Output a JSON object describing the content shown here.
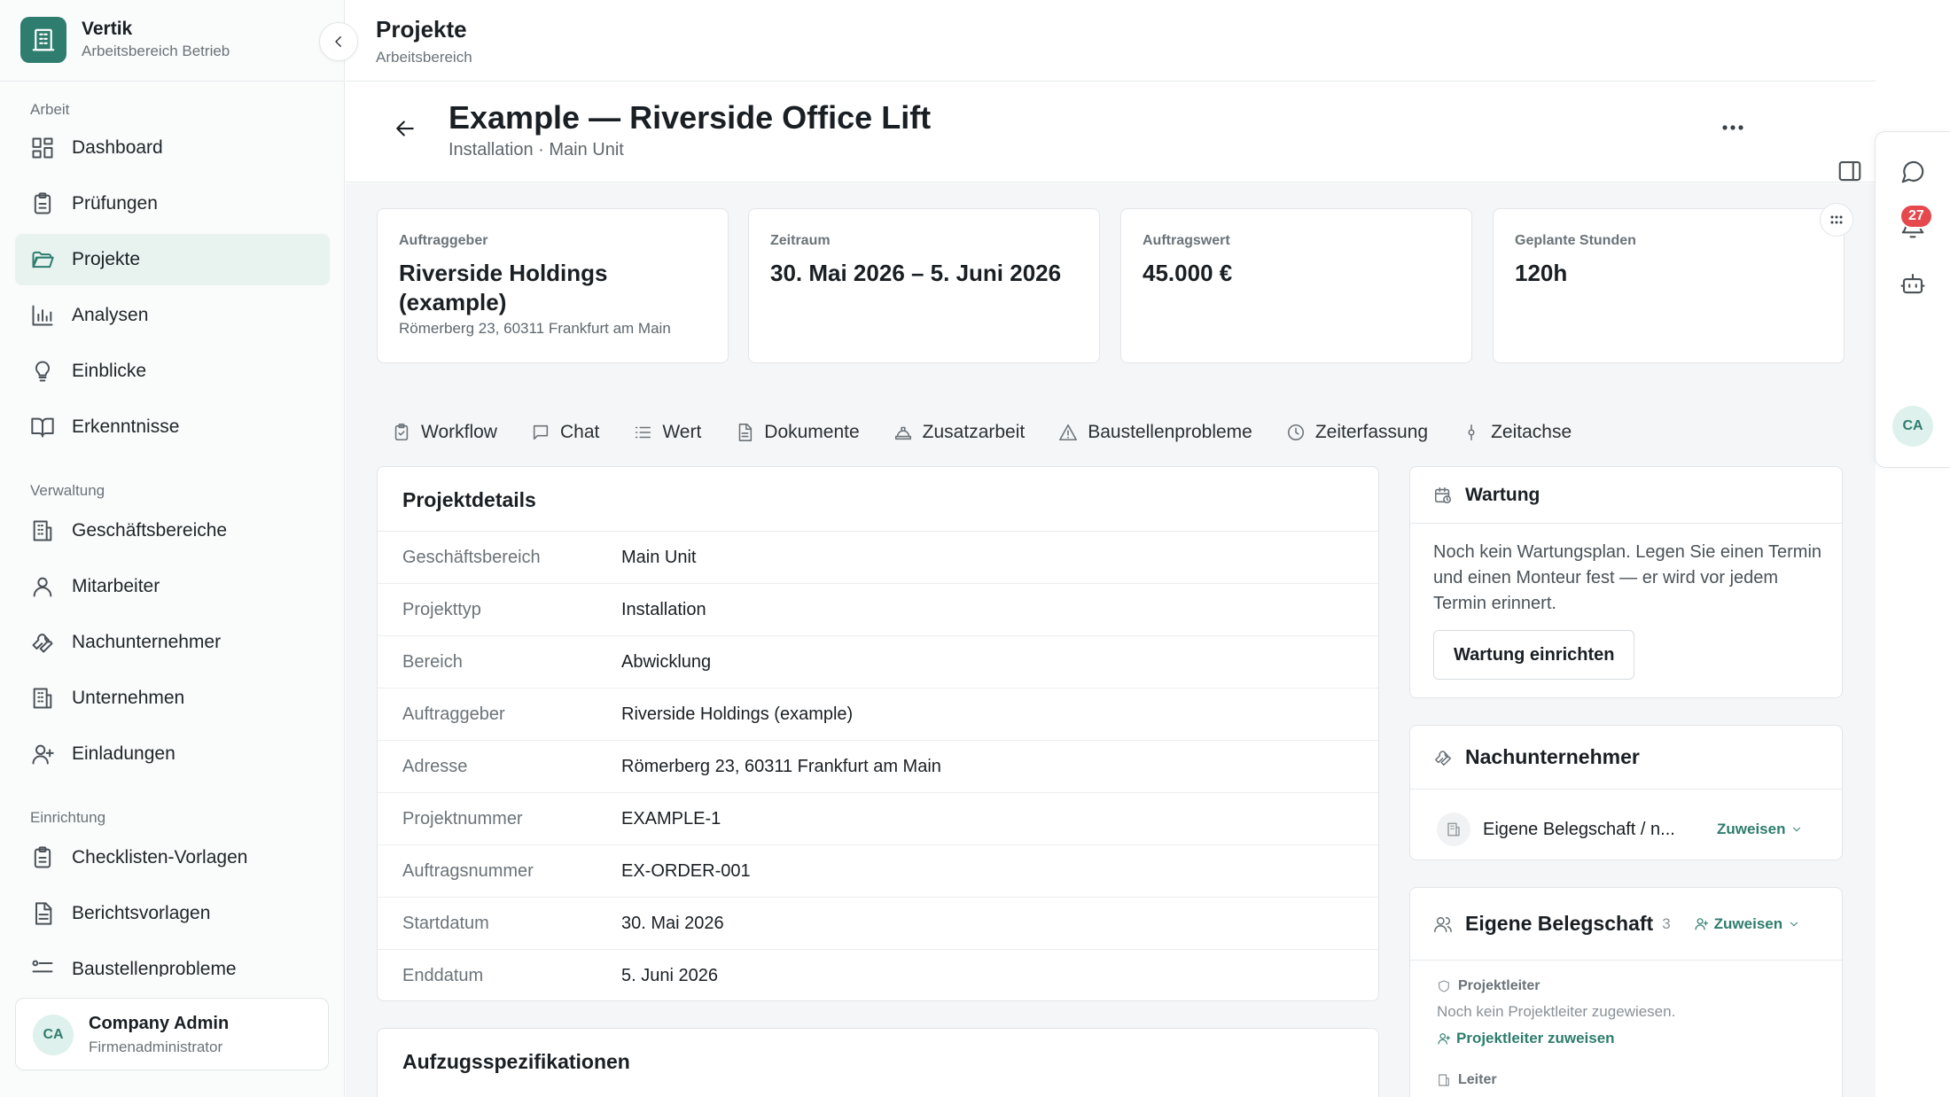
{
  "brand": {
    "name": "Vertik",
    "workspace": "Arbeitsbereich Betrieb"
  },
  "nav": {
    "sections": [
      {
        "label": "Arbeit",
        "items": [
          {
            "label": "Dashboard",
            "icon": "dashboard-icon"
          },
          {
            "label": "Prüfungen",
            "icon": "clipboard-icon"
          },
          {
            "label": "Projekte",
            "icon": "folder-open-icon",
            "active": true
          },
          {
            "label": "Analysen",
            "icon": "bar-chart-icon"
          },
          {
            "label": "Einblicke",
            "icon": "lightbulb-icon"
          },
          {
            "label": "Erkenntnisse",
            "icon": "book-open-icon"
          }
        ]
      },
      {
        "label": "Verwaltung",
        "items": [
          {
            "label": "Geschäftsbereiche",
            "icon": "building-icon"
          },
          {
            "label": "Mitarbeiter",
            "icon": "user-icon"
          },
          {
            "label": "Nachunternehmer",
            "icon": "wrench-icon"
          },
          {
            "label": "Unternehmen",
            "icon": "building-icon"
          },
          {
            "label": "Einladungen",
            "icon": "user-plus-icon"
          }
        ]
      },
      {
        "label": "Einrichtung",
        "items": [
          {
            "label": "Checklisten-Vorlagen",
            "icon": "clipboard-icon"
          },
          {
            "label": "Berichtsvorlagen",
            "icon": "file-text-icon"
          },
          {
            "label": "Baustellenprobleme",
            "icon": "settings-list-icon"
          }
        ]
      }
    ]
  },
  "user": {
    "initials": "CA",
    "name": "Company Admin",
    "role": "Firmenadministrator"
  },
  "topbar": {
    "title": "Projekte",
    "subtitle": "Arbeitsbereich"
  },
  "project": {
    "title": "Example — Riverside Office Lift",
    "subtitle": "Installation · Main Unit"
  },
  "stats": [
    {
      "label": "Auftraggeber",
      "value": "Riverside Holdings (example)",
      "note": "Römerberg 23, 60311 Frankfurt am Main"
    },
    {
      "label": "Zeitraum",
      "value": "30. Mai 2026 – 5. Juni 2026",
      "note": ""
    },
    {
      "label": "Auftragswert",
      "value": "45.000 €",
      "note": ""
    },
    {
      "label": "Geplante Stunden",
      "value": "120h",
      "note": ""
    }
  ],
  "tabs": [
    {
      "label": "Workflow",
      "icon": "clipboard-icon"
    },
    {
      "label": "Chat",
      "icon": "message-square-icon"
    },
    {
      "label": "Wert",
      "icon": "list-icon"
    },
    {
      "label": "Dokumente",
      "icon": "file-icon"
    },
    {
      "label": "Zusatzarbeit",
      "icon": "hard-hat-icon"
    },
    {
      "label": "Baustellenprobleme",
      "icon": "alert-triangle-icon"
    },
    {
      "label": "Zeiterfassung",
      "icon": "clock-icon"
    },
    {
      "label": "Zeitachse",
      "icon": "git-commit-icon"
    }
  ],
  "details": {
    "title": "Projektdetails",
    "rows": [
      {
        "key": "Geschäftsbereich",
        "value": "Main Unit"
      },
      {
        "key": "Projekttyp",
        "value": "Installation"
      },
      {
        "key": "Bereich",
        "value": "Abwicklung"
      },
      {
        "key": "Auftraggeber",
        "value": "Riverside Holdings (example)"
      },
      {
        "key": "Adresse",
        "value": "Römerberg 23, 60311 Frankfurt am Main"
      },
      {
        "key": "Projektnummer",
        "value": "EXAMPLE-1"
      },
      {
        "key": "Auftragsnummer",
        "value": "EX-ORDER-001"
      },
      {
        "key": "Startdatum",
        "value": "30. Mai 2026"
      },
      {
        "key": "Enddatum",
        "value": "5. Juni 2026"
      }
    ]
  },
  "specs": {
    "title": "Aufzugsspezifikationen"
  },
  "wartung": {
    "title": "Wartung",
    "text": "Noch kein Wartungsplan. Legen Sie einen Termin und einen Monteur fest — er wird vor jedem Termin erinnert.",
    "button": "Wartung einrichten"
  },
  "subcontractors": {
    "title": "Nachunternehmer",
    "row_name": "Eigene Belegschaft / n...",
    "assign": "Zuweisen"
  },
  "crew": {
    "title": "Eigene Belegschaft",
    "count": "3",
    "assign": "Zuweisen",
    "role_lead": "Projektleiter",
    "empty_lead": "Noch kein Projektleiter zugewiesen.",
    "assign_lead": "Projektleiter zuweisen",
    "role_manager": "Leiter"
  },
  "rail": {
    "notifications": "27",
    "initials": "CA"
  },
  "colors": {
    "accent": "#2e7d6e",
    "badge": "#e5484d",
    "active_bg": "#e8f3f0"
  }
}
